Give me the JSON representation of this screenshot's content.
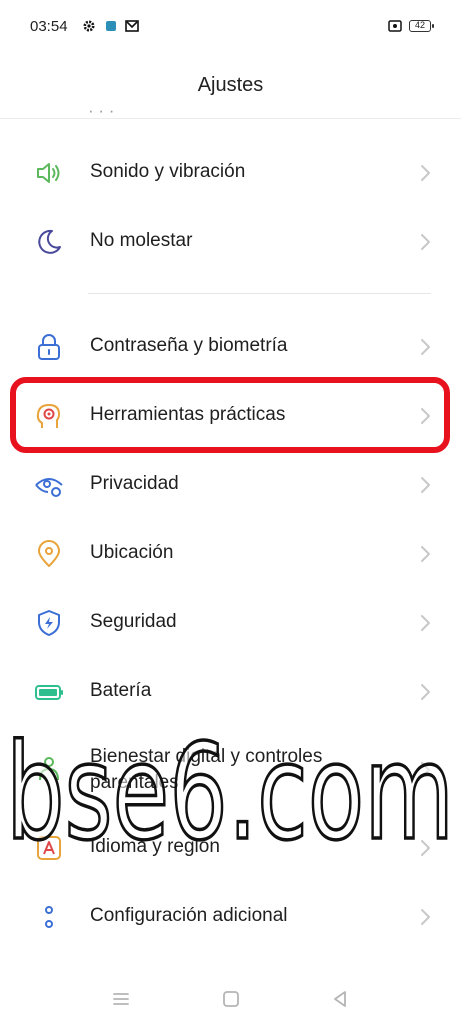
{
  "status_bar": {
    "time": "03:54",
    "battery_level": "42",
    "icons": [
      "gear-icon",
      "app-icon",
      "gmail-icon",
      "screen-record-icon",
      "battery-icon"
    ]
  },
  "header": {
    "title": "Ajustes"
  },
  "items": [
    {
      "label": "Sonido y vibración",
      "icon": "speaker-icon"
    },
    {
      "label": "No molestar",
      "icon": "moon-icon"
    },
    {
      "label": "Contraseña y biometría",
      "icon": "lock-icon"
    },
    {
      "label": "Herramientas prácticas",
      "icon": "head-target-icon"
    },
    {
      "label": "Privacidad",
      "icon": "privacy-eye-icon"
    },
    {
      "label": "Ubicación",
      "icon": "location-pin-icon"
    },
    {
      "label": "Seguridad",
      "icon": "shield-icon"
    },
    {
      "label": "Batería",
      "icon": "battery-icon"
    },
    {
      "label": "Bienestar digital y controles parentales",
      "line1": "Bienestar digital y controles",
      "line2": "parentales",
      "icon": "wellbeing-icon"
    },
    {
      "label": "Idioma y región",
      "icon": "language-icon"
    },
    {
      "label": "Configuración adicional",
      "icon": "more-dots-icon"
    }
  ],
  "watermark": {
    "text": "bse6.com"
  },
  "highlight": {
    "target": "Herramientas prácticas",
    "color": "#e8121f"
  },
  "colors": {
    "highlight": "#e8121f",
    "text": "#1f1f1f",
    "chevron": "#c8c8c8"
  }
}
